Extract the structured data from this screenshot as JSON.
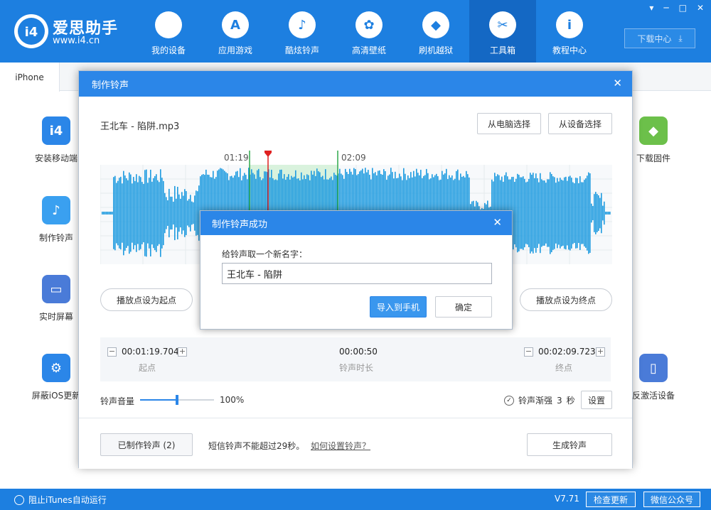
{
  "app": {
    "brand": "爱思助手",
    "url": "www.i4.cn",
    "logo_text": "i4"
  },
  "nav": [
    {
      "label": "我的设备",
      "icon": "apple-icon",
      "glyph": ""
    },
    {
      "label": "应用游戏",
      "icon": "app-store-icon",
      "glyph": "A"
    },
    {
      "label": "酷炫铃声",
      "icon": "bell-icon",
      "glyph": "♪"
    },
    {
      "label": "高清壁纸",
      "icon": "flower-icon",
      "glyph": "✿"
    },
    {
      "label": "刷机越狱",
      "icon": "dropbox-icon",
      "glyph": "◆"
    },
    {
      "label": "工具箱",
      "icon": "tools-icon",
      "glyph": "✂"
    },
    {
      "label": "教程中心",
      "icon": "info-icon",
      "glyph": "i"
    }
  ],
  "window_controls": [
    "▾",
    "─",
    "□",
    "✕"
  ],
  "download_center": "下载中心",
  "tab": "iPhone",
  "tools_left": [
    {
      "label": "安装移动端",
      "icon": "i4-app-icon",
      "glyph": "i4",
      "color": "#2b86e8"
    },
    {
      "label": "制作铃声",
      "icon": "bell-plus-icon",
      "glyph": "♪",
      "color": "#3aa0f0"
    },
    {
      "label": "实时屏幕",
      "icon": "monitor-icon",
      "glyph": "▭",
      "color": "#4a7bd8"
    },
    {
      "label": "屏蔽iOS更新",
      "icon": "gear-icon",
      "glyph": "⚙",
      "color": "#2b86e8"
    }
  ],
  "tools_right": [
    {
      "label": "下载固件",
      "icon": "cube-icon",
      "glyph": "◆",
      "color": "#6cc04a"
    },
    {
      "label": "反激活设备",
      "icon": "tablet-icon",
      "glyph": "▯",
      "color": "#4a7bd8"
    }
  ],
  "statusbar": {
    "itunes": "阻止iTunes自动运行",
    "version": "V7.71",
    "check_update": "检查更新",
    "wechat": "微信公众号"
  },
  "dialog": {
    "title": "制作铃声",
    "filename": "王北车 - 陷阱.mp3",
    "from_pc": "从电脑选择",
    "from_device": "从设备选择",
    "marker_start": "01:19",
    "marker_end": "02:09",
    "set_start": "播放点设为起点",
    "set_end": "播放点设为终点",
    "start_time": "00:01:19.704",
    "start_label": "起点",
    "duration": "00:00:50",
    "duration_label": "铃声时长",
    "end_time": "00:02:09.723",
    "end_label": "终点",
    "volume_label": "铃声音量",
    "volume_value": "100%",
    "volume_level": 0.5,
    "fade_label": "铃声渐强",
    "fade_value": "3",
    "fade_unit": "秒",
    "settings": "设置",
    "made": "已制作铃声 (2)",
    "note": "短信铃声不能超过29秒。",
    "how_link": "如何设置铃声？",
    "generate": "生成铃声"
  },
  "success": {
    "title": "制作铃声成功",
    "prompt": "给铃声取一个新名字：",
    "name_value": "王北车 - 陷阱",
    "import": "导入到手机",
    "ok": "确定"
  },
  "colors": {
    "brand": "#1d7fe0",
    "wave": "#1e9be0",
    "marker": "#e02020",
    "selection": "#2fa84a"
  }
}
